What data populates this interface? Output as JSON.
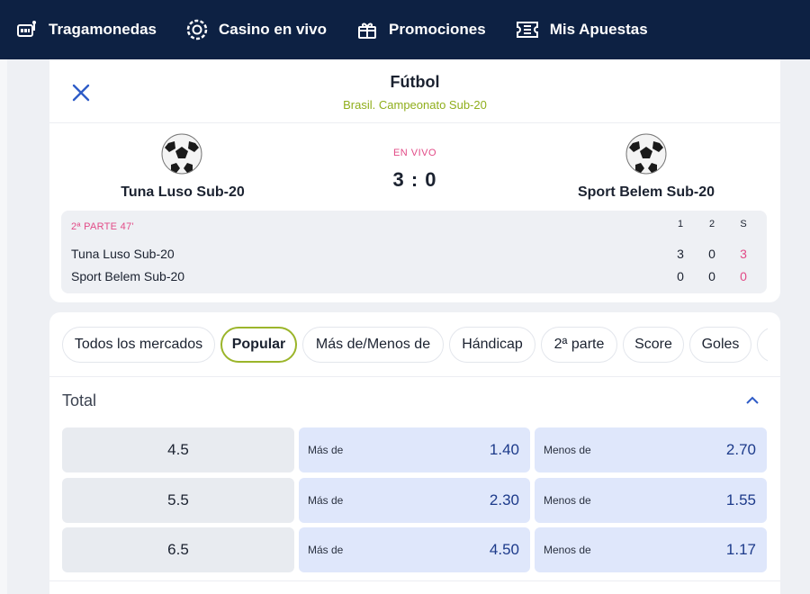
{
  "topnav": {
    "items": [
      {
        "label": "Tragamonedas",
        "icon": "slot-machine-icon"
      },
      {
        "label": "Casino en vivo",
        "icon": "roulette-chip-icon"
      },
      {
        "label": "Promociones",
        "icon": "gift-icon"
      },
      {
        "label": "Mis Apuestas",
        "icon": "ticket-icon"
      }
    ]
  },
  "event": {
    "sport": "Fútbol",
    "league": "Brasil. Campeonato Sub-20",
    "status": "EN VIVO",
    "score": "3 : 0",
    "home": "Tuna Luso Sub-20",
    "away": "Sport Belem Sub-20"
  },
  "scoreboard": {
    "period": "2ª PARTE 47'",
    "headers": [
      "1",
      "2",
      "S"
    ],
    "rows": [
      {
        "team": "Tuna Luso Sub-20",
        "values": [
          "3",
          "0",
          "3"
        ]
      },
      {
        "team": "Sport Belem Sub-20",
        "values": [
          "0",
          "0",
          "0"
        ]
      }
    ]
  },
  "market_tabs": [
    "Todos los mercados",
    "Popular",
    "Más de/Menos de",
    "Hándicap",
    "2ª parte",
    "Score",
    "Goles"
  ],
  "active_tab": "Popular",
  "market": {
    "title": "Total",
    "rows": [
      {
        "line": "4.5",
        "over_label": "Más de",
        "over_odds": "1.40",
        "under_label": "Menos de",
        "under_odds": "2.70"
      },
      {
        "line": "5.5",
        "over_label": "Más de",
        "over_odds": "2.30",
        "under_label": "Menos de",
        "under_odds": "1.55"
      },
      {
        "line": "6.5",
        "over_label": "Más de",
        "over_odds": "4.50",
        "under_label": "Menos de",
        "under_odds": "1.17"
      }
    ]
  },
  "colors": {
    "nav_bg": "#0d2143",
    "accent_green": "#8fae1b",
    "live_pink": "#e24b87",
    "odds_blue": "#1c3a8a",
    "odds_bg": "#dfe7fb"
  }
}
